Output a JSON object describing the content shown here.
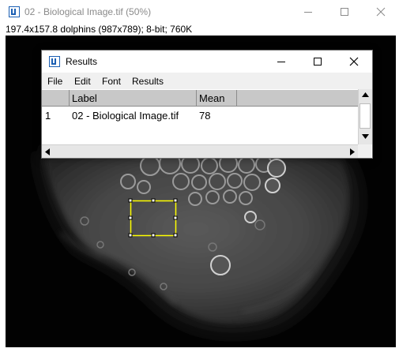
{
  "window": {
    "title": "02 - Biological Image.tif (50%)",
    "info": "197.4x157.8 dolphins (987x789); 8-bit; 760K"
  },
  "results": {
    "title": "Results",
    "menu": [
      "File",
      "Edit",
      "Font",
      "Results"
    ],
    "columns": [
      "",
      "Label",
      "Mean"
    ],
    "rows": [
      {
        "index": "1",
        "label": "02 - Biological Image.tif",
        "mean": "78"
      }
    ]
  },
  "colors": {
    "roi": "#ffff00",
    "image_background": "#020202",
    "table_header": "#c8c8c8"
  },
  "icons": [
    "imagej-icon",
    "minimize-icon",
    "maximize-icon",
    "close-icon",
    "scroll-up-icon",
    "scroll-down-icon",
    "scroll-left-icon",
    "scroll-right-icon"
  ]
}
